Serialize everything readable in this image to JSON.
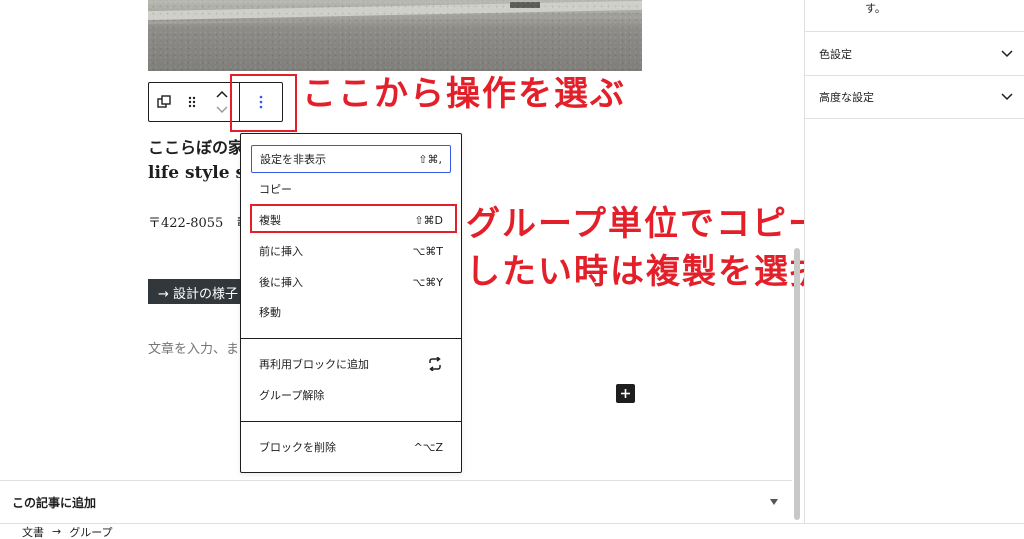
{
  "content": {
    "heading_line1": "ここらぼの家",
    "heading_line2": "life style s",
    "address": "〒422-8055",
    "address_tail": "静",
    "button_label": "→ 設計の様子",
    "paragraph_placeholder": "文章を入力、または"
  },
  "options_menu": {
    "items": [
      {
        "label": "設定を非表示",
        "shortcut": "⇧⌘,"
      },
      {
        "label": "コピー",
        "shortcut": ""
      },
      {
        "label": "複製",
        "shortcut": "⇧⌘D"
      },
      {
        "label": "前に挿入",
        "shortcut": "⌥⌘T"
      },
      {
        "label": "後に挿入",
        "shortcut": "⌥⌘Y"
      },
      {
        "label": "移動",
        "shortcut": ""
      },
      {
        "label": "再利用ブロックに追加",
        "shortcut": ""
      },
      {
        "label": "グループ解除",
        "shortcut": ""
      },
      {
        "label": "ブロックを削除",
        "shortcut": "^⌥Z"
      }
    ]
  },
  "annotations": {
    "toolbar_hint": "ここから操作を選ぶ",
    "duplicate_hint_line1": "グループ単位でコピー",
    "duplicate_hint_line2": "したい時は複製を選択"
  },
  "sidebar": {
    "text_fragment": "す。",
    "panels": [
      {
        "label": "色設定"
      },
      {
        "label": "高度な設定"
      }
    ]
  },
  "metabox": {
    "title": "この記事に追加"
  },
  "breadcrumb": {
    "items": [
      "文書",
      "グループ"
    ],
    "separator": "→"
  },
  "icons": {
    "toolbar": [
      "select-parent-icon",
      "drag-handle-icon",
      "move-up-down-icon",
      "more-options-icon"
    ],
    "reusable": "reusable-arrows-icon",
    "add_block": "plus-icon",
    "panel_toggle": "chevron-down-icon"
  },
  "colors": {
    "annotation": "#e3202a",
    "focus": "#3858e9",
    "ui_dark": "#1e1e1e"
  }
}
